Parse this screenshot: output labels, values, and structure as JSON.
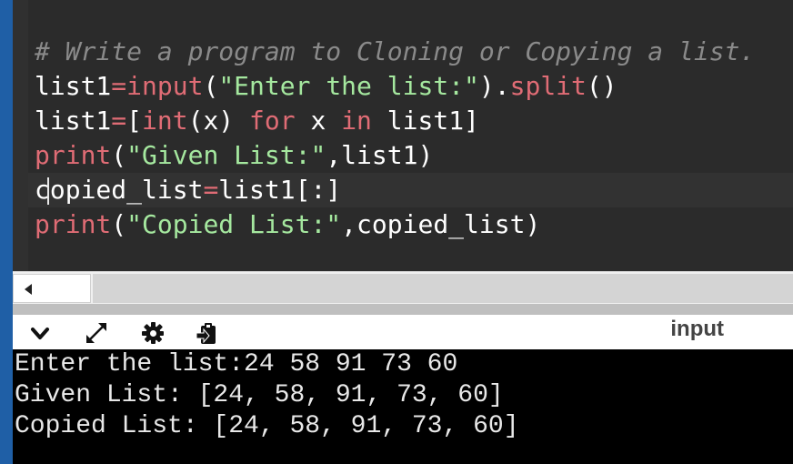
{
  "editor": {
    "comment": "# Write a program to Cloning or Copying a list.",
    "line2": {
      "var": "list1",
      "eq": "=",
      "fn": "input",
      "open": "(",
      "str": "\"Enter the list:\"",
      "close": ").",
      "method": "split",
      "end": "()"
    },
    "line3": {
      "var": "list1",
      "eq": "=",
      "open": "[",
      "fn": "int",
      "mid": "(x) ",
      "kw1": "for",
      "mid2": " x ",
      "kw2": "in",
      "end": " list1]"
    },
    "line4": {
      "fn": "print",
      "open": "(",
      "str": "\"Given List:\"",
      "end": ",list1)"
    },
    "line5": {
      "var": "copied_list",
      "eq": "=",
      "end": "list1[:]"
    },
    "line6": {
      "fn": "print",
      "open": "(",
      "str": "\"Copied List:\"",
      "end": ",copied_list)"
    }
  },
  "toolbar": {
    "icons": [
      "chevron-down-icon",
      "expand-icon",
      "gear-icon",
      "clipboard-icon"
    ],
    "label": "input"
  },
  "console": {
    "lines": [
      "Enter the list:24 58 91 73 60",
      "Given List: [24, 58, 91, 73, 60]",
      "Copied List: [24, 58, 91, 73, 60]"
    ]
  },
  "colors": {
    "editor_bg": "#2b2b2b",
    "keyword": "#e06c75",
    "string": "#a5e89f",
    "comment": "#8a8a8a",
    "sidebar": "#1f5fa6"
  }
}
